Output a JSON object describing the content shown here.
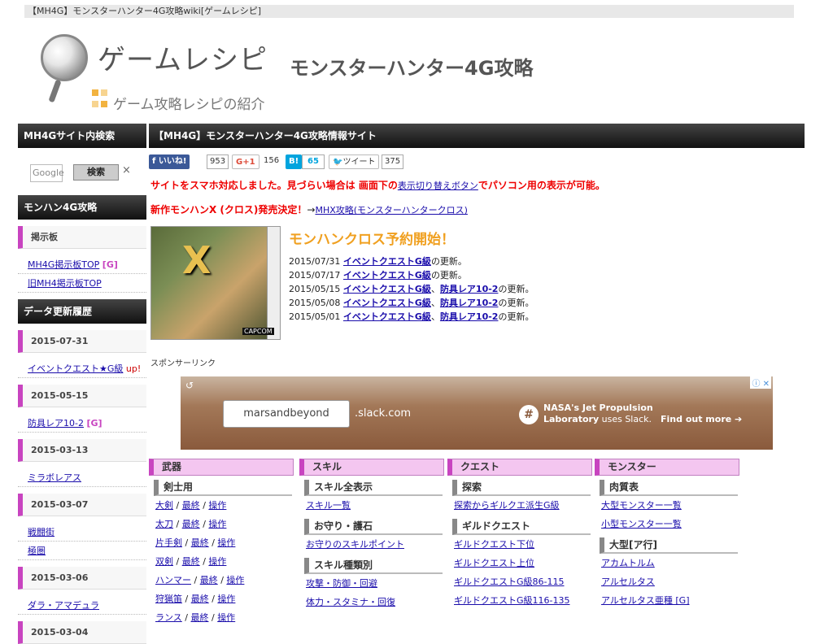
{
  "top_title": "【MH4G】モンスターハンター4G攻略wiki[ゲームレシピ]",
  "logo": {
    "name": "ゲームレシピ",
    "tagline": "ゲーム攻略レシピの紹介"
  },
  "site_title": "モンスターハンター4G攻略",
  "sidebar": {
    "search_head": "MH4Gサイト内検索",
    "search_placeholder": "Google",
    "search_button": "検索",
    "search_clear": "×",
    "mh4g_head": "モンハン4G攻略",
    "board_sub": "掲示板",
    "board_links": [
      {
        "label": "MH4G掲示板TOP",
        "tag": "[G]"
      },
      {
        "label": "旧MH4掲示板TOP",
        "tag": ""
      }
    ],
    "history_head": "データ更新履歴",
    "history": [
      {
        "date": "2015-07-31",
        "links": [
          {
            "label": "イベントクエスト★G級",
            "tag": "up!"
          }
        ]
      },
      {
        "date": "2015-05-15",
        "links": [
          {
            "label": "防具レア10-2",
            "tag": "[G]"
          }
        ]
      },
      {
        "date": "2015-03-13",
        "links": [
          {
            "label": "ミラボレアス",
            "tag": ""
          }
        ]
      },
      {
        "date": "2015-03-07",
        "links": [
          {
            "label": "戦闘街",
            "tag": ""
          },
          {
            "label": "極圏",
            "tag": ""
          }
        ]
      },
      {
        "date": "2015-03-06",
        "links": [
          {
            "label": "ダラ・アマデュラ",
            "tag": ""
          }
        ]
      },
      {
        "date": "2015-03-04",
        "links": []
      }
    ]
  },
  "main": {
    "head": "【MH4G】モンスターハンター4G攻略情報サイト",
    "social": {
      "fb_label": "いいね!",
      "fb_count": "953",
      "gplus_label": "G+1",
      "gplus_count": "156",
      "hatena_label": "B!",
      "hatena_count": "65",
      "tweet_label": "ツイート",
      "tweet_count": "375"
    },
    "notice_pre": "サイトをスマホ対応しました。見づらい場合は 画面下の",
    "notice_link": "表示切り替えボタン",
    "notice_post": "でパソコン用の表示が可能。",
    "new_title": "新作モンハンX (クロス)発売決定！",
    "new_arrow": "→",
    "new_link": "MHX攻略(モンスターハンタークロス)",
    "box_art_logo": "X",
    "box_art_capcom": "CAPCOM",
    "yoyaku": "モンハンクロス予約開始！",
    "updates": [
      {
        "date": "2015/07/31",
        "links": [
          "イベントクエストG級"
        ],
        "suffix": "の更新。"
      },
      {
        "date": "2015/07/17",
        "links": [
          "イベントクエストG級"
        ],
        "suffix": "の更新。"
      },
      {
        "date": "2015/05/15",
        "links": [
          "イベントクエストG級",
          "防具レア10-2"
        ],
        "suffix": "の更新。"
      },
      {
        "date": "2015/05/08",
        "links": [
          "イベントクエストG級",
          "防具レア10-2"
        ],
        "suffix": "の更新。"
      },
      {
        "date": "2015/05/01",
        "links": [
          "イベントクエストG級",
          "防具レア10-2"
        ],
        "suffix": "の更新。"
      }
    ],
    "sponsor": "スポンサーリンク",
    "ad": {
      "input": "marsandbeyond",
      "domain": ".slack.com",
      "nasa_line1": "NASA's Jet Propulsion",
      "nasa_line2": "Laboratory",
      "nasa_line3": "uses Slack.",
      "find": "Find out more ➔"
    }
  },
  "categories": [
    {
      "head": "武器",
      "groups": [
        {
          "sub": "剣士用",
          "links": [
            [
              "大剣",
              "最終",
              "操作"
            ],
            [
              "太刀",
              "最終",
              "操作"
            ],
            [
              "片手剣",
              "最終",
              "操作"
            ],
            [
              "双剣",
              "最終",
              "操作"
            ],
            [
              "ハンマー",
              "最終",
              "操作"
            ],
            [
              "狩猟笛",
              "最終",
              "操作"
            ],
            [
              "ランス",
              "最終",
              "操作"
            ]
          ]
        }
      ]
    },
    {
      "head": "スキル",
      "groups": [
        {
          "sub": "スキル全表示",
          "links": [
            [
              "スキル一覧"
            ]
          ]
        },
        {
          "sub": "お守り・護石",
          "links": [
            [
              "お守りのスキルポイント"
            ]
          ]
        },
        {
          "sub": "スキル種類別",
          "links": [
            [
              "攻撃・防御・回避"
            ],
            [
              "体力・スタミナ・回復"
            ]
          ]
        }
      ]
    },
    {
      "head": "クエスト",
      "groups": [
        {
          "sub": "探索",
          "links": [
            [
              "探索からギルクエ派生G級"
            ]
          ]
        },
        {
          "sub": "ギルドクエスト",
          "links": [
            [
              "ギルドクエスト下位"
            ],
            [
              "ギルドクエスト上位"
            ],
            [
              "ギルドクエストG級86-115"
            ],
            [
              "ギルドクエストG級116-135"
            ]
          ]
        }
      ]
    },
    {
      "head": "モンスター",
      "groups": [
        {
          "sub": "肉質表",
          "links": [
            [
              "大型モンスター一覧"
            ],
            [
              "小型モンスター一覧"
            ]
          ]
        },
        {
          "sub": "大型[ア行]",
          "links": [
            [
              "アカムトルム"
            ],
            [
              "アルセルタス"
            ],
            [
              "アルセルタス亜種 [G]"
            ]
          ]
        }
      ]
    }
  ]
}
